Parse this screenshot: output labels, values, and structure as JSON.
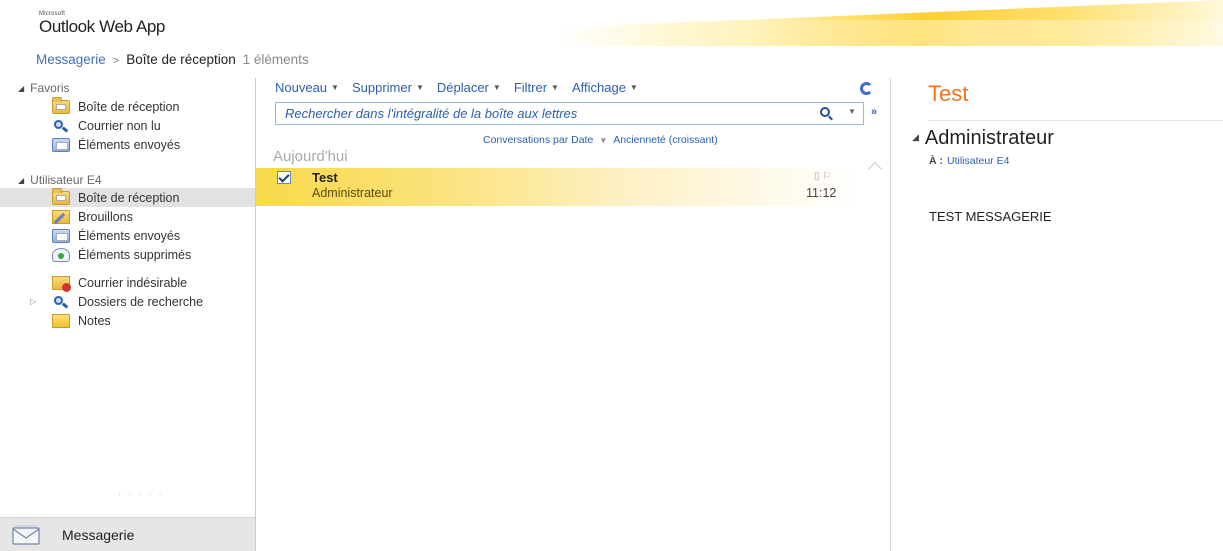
{
  "brand": {
    "small": "Microsoft",
    "name": "Outlook Web App"
  },
  "breadcrumb": {
    "root": "Messagerie",
    "separator": ">",
    "current": "Boîte de réception",
    "count": "1 éléments"
  },
  "nav": {
    "favorites": {
      "label": "Favoris",
      "items": [
        {
          "label": "Boîte de réception",
          "icon": "inbox-folder-icon"
        },
        {
          "label": "Courrier non lu",
          "icon": "search-folder-icon"
        },
        {
          "label": "Éléments envoyés",
          "icon": "sent-items-icon"
        }
      ]
    },
    "mailbox": {
      "label": "Utilisateur E4",
      "items": [
        {
          "label": "Boîte de réception",
          "icon": "inbox-folder-icon",
          "selected": true
        },
        {
          "label": "Brouillons",
          "icon": "drafts-icon"
        },
        {
          "label": "Éléments envoyés",
          "icon": "sent-items-icon"
        },
        {
          "label": "Éléments supprimés",
          "icon": "deleted-items-icon"
        },
        {
          "label": "Courrier indésirable",
          "icon": "junk-mail-icon"
        },
        {
          "label": "Dossiers de recherche",
          "icon": "search-folder-icon"
        },
        {
          "label": "Notes",
          "icon": "notes-icon"
        }
      ]
    },
    "bottom": {
      "label": "Messagerie",
      "icon": "mail-envelope-icon"
    }
  },
  "toolbar": {
    "new": "Nouveau",
    "delete": "Supprimer",
    "move": "Déplacer",
    "filter": "Filtrer",
    "view": "Affichage"
  },
  "search": {
    "placeholder": "Rechercher dans l'intégralité de la boîte aux lettres"
  },
  "sort": {
    "arrange": "Conversations par Date",
    "order": "Ancienneté (croissant)"
  },
  "list": {
    "group": "Aujourd'hui",
    "messages": [
      {
        "subject": "Test",
        "from": "Administrateur",
        "time": "11:12",
        "selected": true,
        "checked": true
      }
    ]
  },
  "reading": {
    "subject": "Test",
    "from": "Administrateur",
    "to_label": "À :",
    "to": "Utilisateur E4",
    "body": "TEST MESSAGERIE"
  },
  "colors": {
    "accent_orange": "#f0731f",
    "link_blue": "#2c5fb0",
    "selection_yellow": "#f8d94a",
    "nav_selected": "#e2e2e2"
  }
}
